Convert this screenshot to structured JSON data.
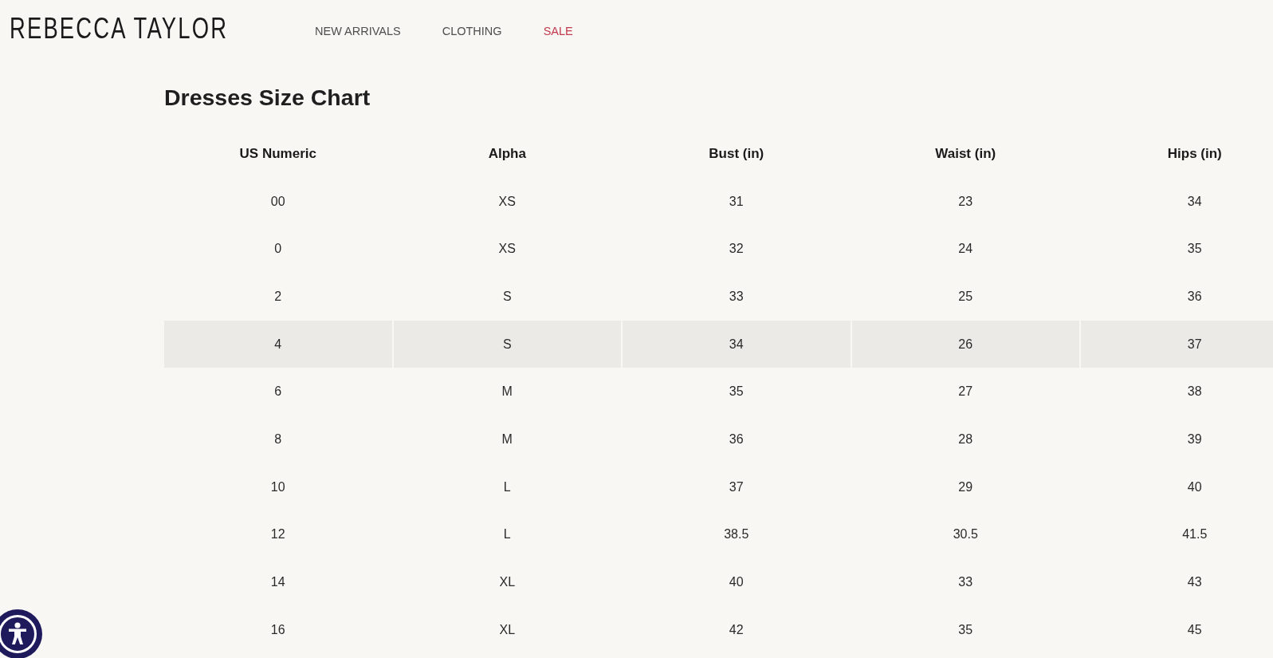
{
  "brand": {
    "logo": "REBECCA TAYLOR"
  },
  "nav": [
    {
      "label": "NEW ARRIVALS",
      "color": "#4f4f4f"
    },
    {
      "label": "CLOTHING",
      "color": "#4f4f4f"
    },
    {
      "label": "SALE",
      "color": "#c23b4e"
    }
  ],
  "page": {
    "title": "Dresses Size Chart"
  },
  "table": {
    "columns": [
      "US Numeric",
      "Alpha",
      "Bust (in)",
      "Waist (in)",
      "Hips (in)"
    ],
    "rows": [
      {
        "cells": [
          "00",
          "XS",
          "31",
          "23",
          "34"
        ],
        "highlighted": false
      },
      {
        "cells": [
          "0",
          "XS",
          "32",
          "24",
          "35"
        ],
        "highlighted": false
      },
      {
        "cells": [
          "2",
          "S",
          "33",
          "25",
          "36"
        ],
        "highlighted": false
      },
      {
        "cells": [
          "4",
          "S",
          "34",
          "26",
          "37"
        ],
        "highlighted": true
      },
      {
        "cells": [
          "6",
          "M",
          "35",
          "27",
          "38"
        ],
        "highlighted": false
      },
      {
        "cells": [
          "8",
          "M",
          "36",
          "28",
          "39"
        ],
        "highlighted": false
      },
      {
        "cells": [
          "10",
          "L",
          "37",
          "29",
          "40"
        ],
        "highlighted": false
      },
      {
        "cells": [
          "12",
          "L",
          "38.5",
          "30.5",
          "41.5"
        ],
        "highlighted": false
      },
      {
        "cells": [
          "14",
          "XL",
          "40",
          "33",
          "43"
        ],
        "highlighted": false
      },
      {
        "cells": [
          "16",
          "XL",
          "42",
          "35",
          "45"
        ],
        "highlighted": false
      }
    ]
  }
}
